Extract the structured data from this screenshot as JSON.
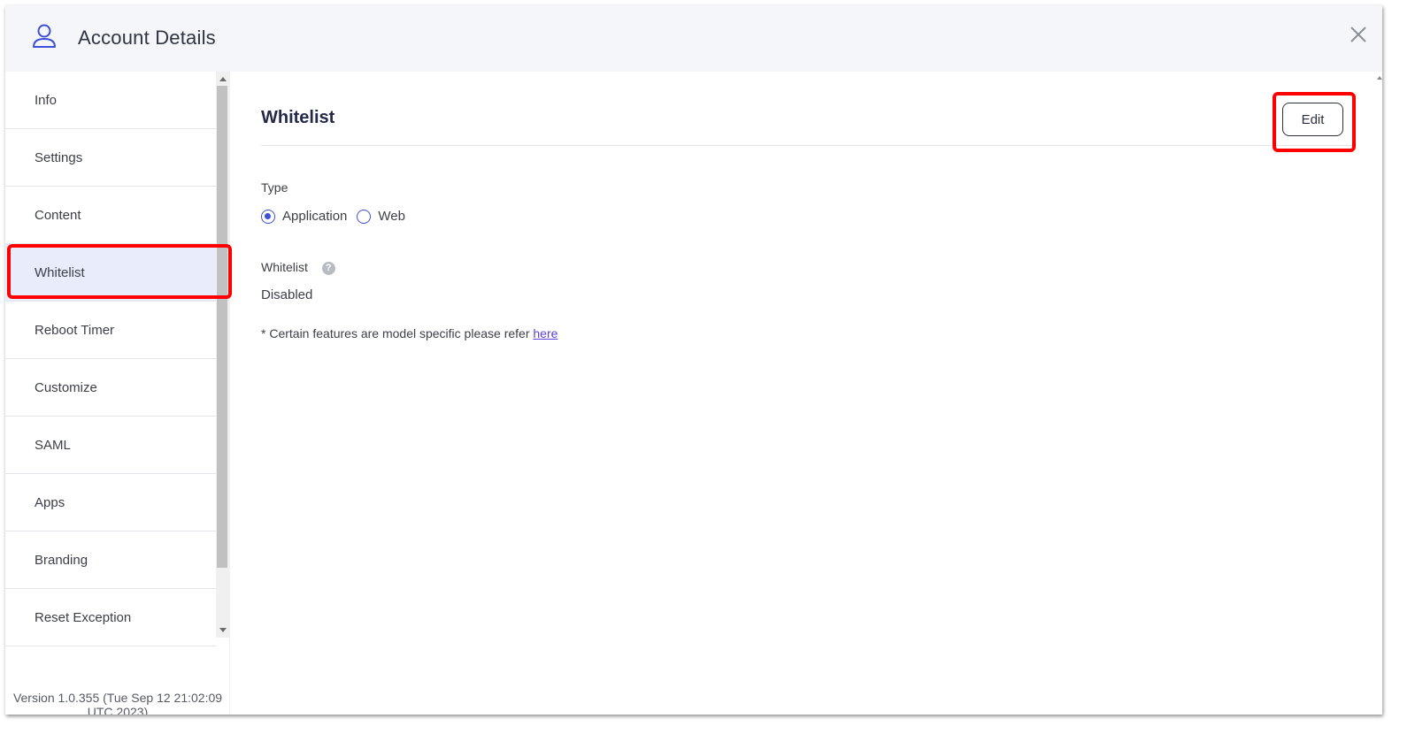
{
  "header": {
    "title": "Account Details"
  },
  "sidebar": {
    "items": [
      {
        "label": "Info"
      },
      {
        "label": "Settings"
      },
      {
        "label": "Content"
      },
      {
        "label": "Whitelist",
        "active": true
      },
      {
        "label": "Reboot Timer"
      },
      {
        "label": "Customize"
      },
      {
        "label": "SAML"
      },
      {
        "label": "Apps"
      },
      {
        "label": "Branding"
      },
      {
        "label": "Reset Exception"
      }
    ],
    "version_line1": "Version 1.0.355 (Tue Sep 12 21:02:09",
    "version_line2": "UTC 2023)"
  },
  "main": {
    "section_title": "Whitelist",
    "edit_label": "Edit",
    "type_label": "Type",
    "type_options": [
      {
        "label": "Application",
        "checked": true
      },
      {
        "label": "Web",
        "checked": false
      }
    ],
    "whitelist_label": "Whitelist",
    "help_glyph": "?",
    "whitelist_value": "Disabled",
    "note_text": "* Certain features are model specific please refer ",
    "note_link": "here"
  },
  "colors": {
    "accent": "#3e4fd8",
    "highlight": "#ff0000",
    "active_bg": "#e8ecfb",
    "title": "#24294a"
  },
  "icons": {
    "header": "user-icon",
    "close": "close-icon",
    "help": "help-icon"
  }
}
